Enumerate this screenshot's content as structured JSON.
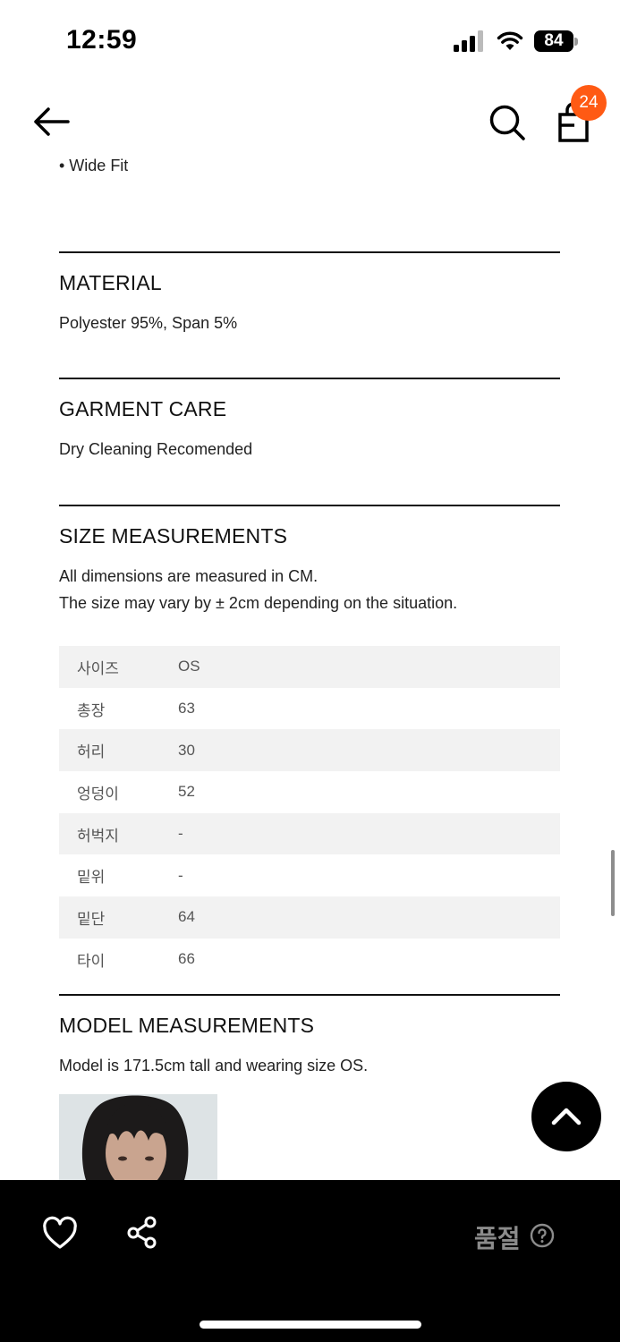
{
  "status_bar": {
    "time": "12:59",
    "battery": "84"
  },
  "header": {
    "cart_count": "24"
  },
  "clipped_text": "• Wide Fit",
  "material": {
    "title": "MATERIAL",
    "text": "Polyester 95%, Span 5%"
  },
  "garment_care": {
    "title": "GARMENT CARE",
    "text": "Dry Cleaning Recomended"
  },
  "size_measurements": {
    "title": "SIZE MEASUREMENTS",
    "line1": "All dimensions are measured in CM.",
    "line2": "The size may vary by ± 2cm depending on the situation.",
    "rows": [
      {
        "label": "사이즈",
        "value": "OS"
      },
      {
        "label": "총장",
        "value": "63"
      },
      {
        "label": "허리",
        "value": "30"
      },
      {
        "label": "엉덩이",
        "value": "52"
      },
      {
        "label": "허벅지",
        "value": "-"
      },
      {
        "label": "밑위",
        "value": "-"
      },
      {
        "label": "밑단",
        "value": "64"
      },
      {
        "label": "타이",
        "value": "66"
      }
    ]
  },
  "model_measurements": {
    "title": "MODEL MEASUREMENTS",
    "text": "Model is 171.5cm tall and wearing size OS."
  },
  "bottom_bar": {
    "soldout_label": "품절"
  },
  "colors": {
    "badge": "#ff5a14",
    "bar": "#000000",
    "row_shade": "#f2f2f2"
  },
  "icons": [
    "back-arrow-icon",
    "search-icon",
    "shopping-bag-icon",
    "heart-icon",
    "share-icon",
    "help-icon",
    "chevron-up-icon"
  ]
}
